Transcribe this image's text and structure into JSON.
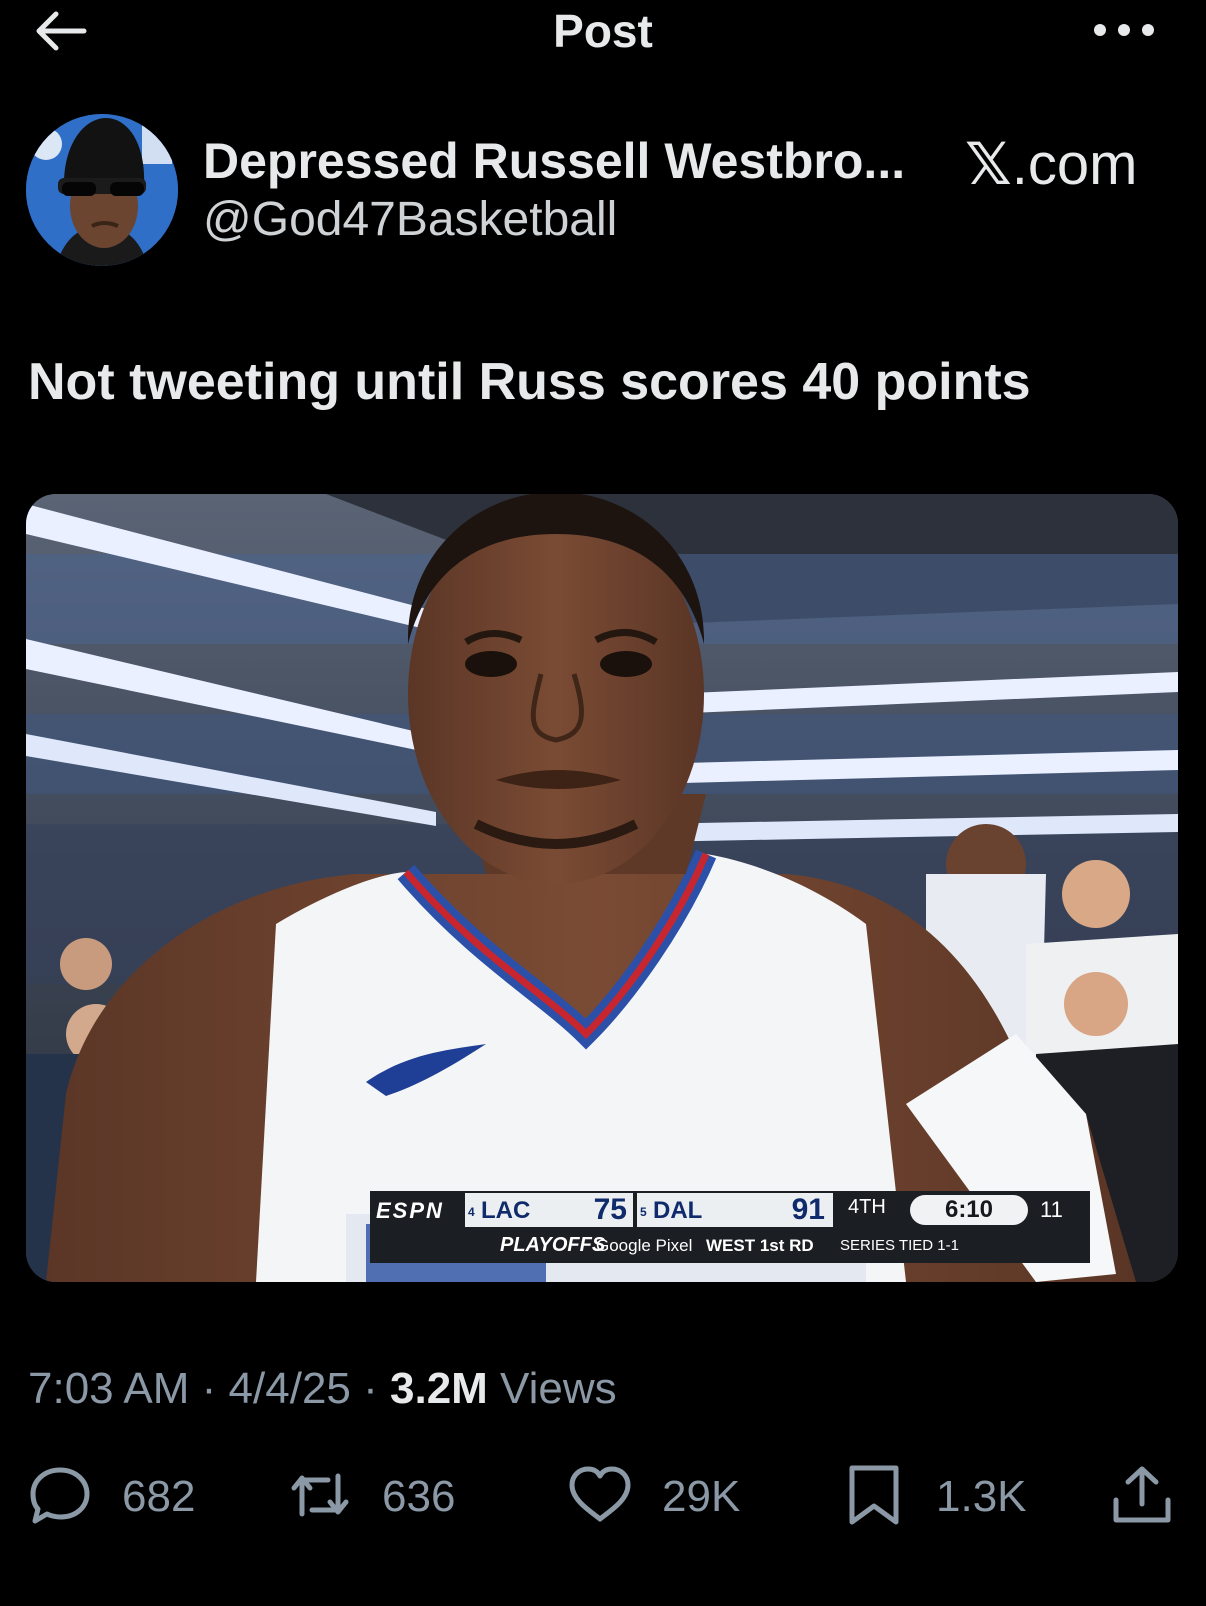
{
  "header": {
    "title": "Post"
  },
  "author": {
    "display_name": "Depressed Russell Westbro...",
    "handle": "@God47Basketball",
    "source_x": "𝕏",
    "source_domain": ".com"
  },
  "tweet": {
    "text": "Not tweeting until Russ scores 40 points"
  },
  "scorebug": {
    "network": "ESPN",
    "team1_seed": "4",
    "team1": "LAC",
    "team1_score": "75",
    "team2_seed": "5",
    "team2": "DAL",
    "team2_score": "91",
    "period": "4TH",
    "clock": "6:10",
    "shot_clock": "11",
    "playoffs": "PLAYOFFS",
    "sponsor": "Google Pixel",
    "round": "WEST 1st RD",
    "series": "SERIES TIED 1-1"
  },
  "meta": {
    "time": "7:03 AM",
    "sep1": " · ",
    "date": "4/4/25",
    "sep2": " · ",
    "views_count": "3.2M",
    "views_label": " Views"
  },
  "actions": {
    "replies": "682",
    "reposts": "636",
    "likes": "29K",
    "bookmarks": "1.3K"
  },
  "colors": {
    "background": "#000000",
    "text_primary": "#e7e9ea",
    "text_secondary": "#8b98a5"
  },
  "icons": [
    "back-arrow-icon",
    "more-icon",
    "reply-icon",
    "repost-icon",
    "like-icon",
    "bookmark-icon",
    "share-icon"
  ]
}
